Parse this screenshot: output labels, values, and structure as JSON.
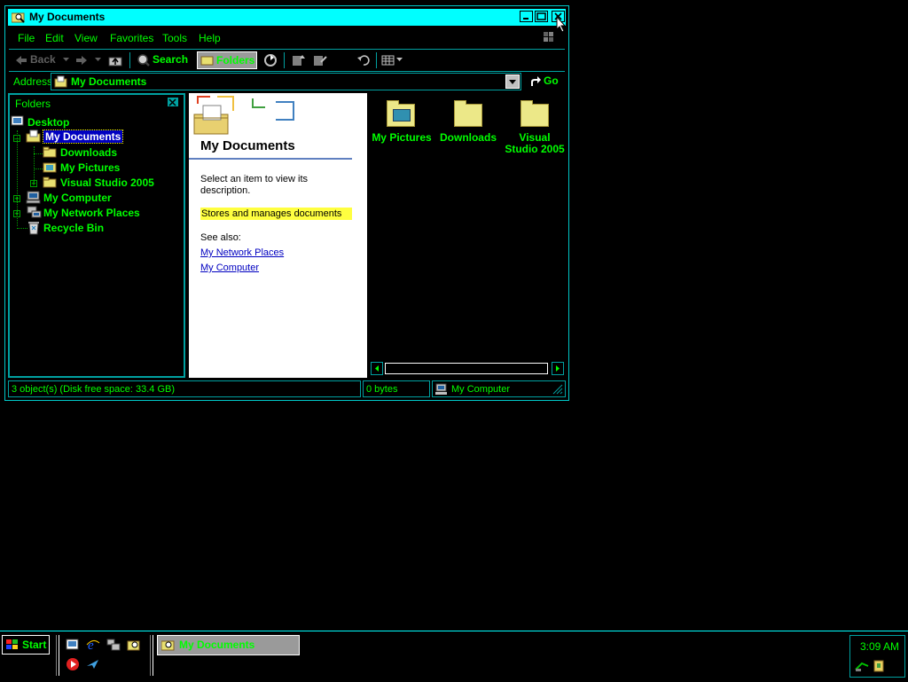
{
  "window": {
    "title": "My Documents",
    "minimize_icon": "minimize-icon",
    "maximize_icon": "maximize-icon",
    "close_icon": "close-icon"
  },
  "menubar": {
    "items": [
      "File",
      "Edit",
      "View",
      "Favorites",
      "Tools",
      "Help"
    ]
  },
  "toolbar": {
    "back_label": "Back",
    "search_label": "Search",
    "folders_label": "Folders"
  },
  "address": {
    "label": "Address",
    "value": "My Documents",
    "go_label": "Go"
  },
  "folders_pane": {
    "title": "Folders",
    "items": [
      {
        "label": "Desktop",
        "icon": "desktop-icon"
      },
      {
        "label": "My Documents",
        "icon": "my-documents-icon",
        "selected": true
      },
      {
        "label": "Downloads",
        "icon": "folder-icon"
      },
      {
        "label": "My Pictures",
        "icon": "pictures-folder-icon"
      },
      {
        "label": "Visual Studio 2005",
        "icon": "folder-icon"
      },
      {
        "label": "My Computer",
        "icon": "computer-icon"
      },
      {
        "label": "My Network Places",
        "icon": "network-icon"
      },
      {
        "label": "Recycle Bin",
        "icon": "recycle-bin-icon"
      }
    ]
  },
  "info_pane": {
    "title": "My Documents",
    "description": "Select an item to view its description.",
    "highlight": "Stores and manages documents",
    "see_also": "See also:",
    "links": [
      "My Network Places",
      "My Computer"
    ]
  },
  "files": [
    {
      "label": "My Pictures",
      "icon": "pictures-folder-icon"
    },
    {
      "label": "Downloads",
      "icon": "folder-icon"
    },
    {
      "label": "Visual Studio 2005",
      "icon": "folder-icon"
    }
  ],
  "statusbar": {
    "objects": "3 object(s) (Disk free space: 33.4 GB)",
    "size": "0 bytes",
    "zone": "My Computer"
  },
  "taskbar": {
    "start_label": "Start",
    "task_label": "My Documents",
    "clock": "3:09 AM"
  },
  "colors": {
    "accent": "#00ffff",
    "text": "#00ff00",
    "selection": "#0000c0",
    "highlight": "#ffff40"
  }
}
